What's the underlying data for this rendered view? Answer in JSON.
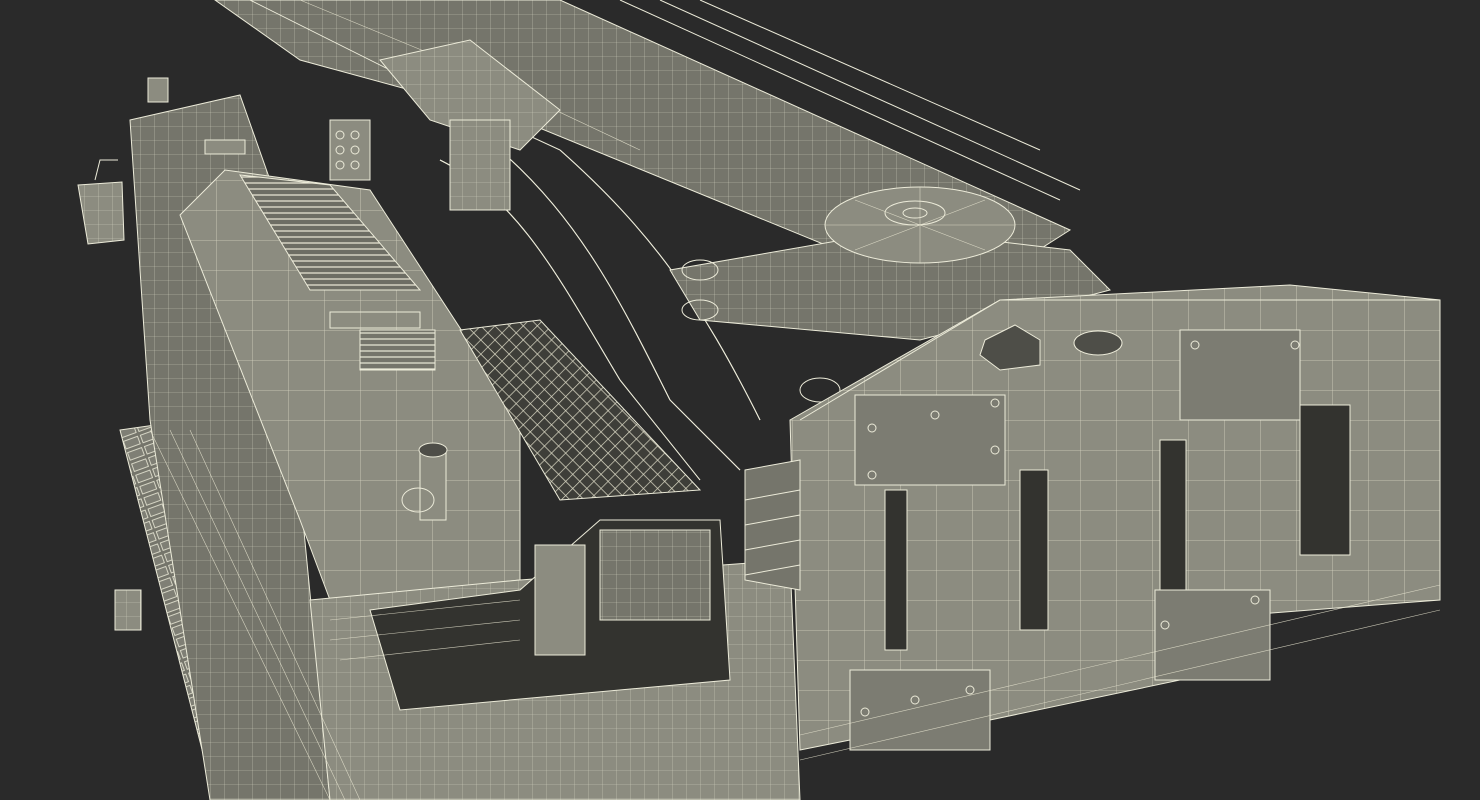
{
  "scene": {
    "background": "#2a2a2a",
    "wire_color": "#ecebd9",
    "surface_light": "#8c8c80",
    "surface_mid": "#75756b",
    "surface_dark": "#4e4e48",
    "icon": "wireframe-machine-render"
  }
}
